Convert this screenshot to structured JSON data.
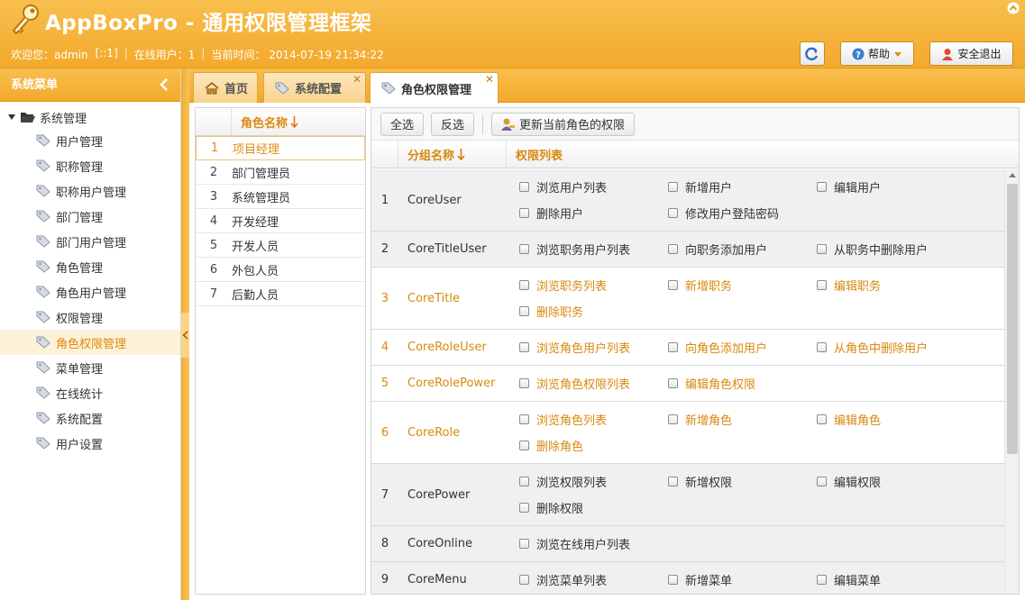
{
  "app": {
    "title": "AppBoxPro - 通用权限管理框架"
  },
  "status": {
    "welcome": "欢迎您：admin",
    "ip": "[::1]",
    "online": "在线用户：1",
    "time": "当前时间：  2014-07-19 21:34:22"
  },
  "header_buttons": {
    "help": "帮助",
    "logout": "安全退出"
  },
  "sidebar": {
    "title": "系统菜单",
    "root": "系统管理",
    "items": [
      {
        "label": "用户管理"
      },
      {
        "label": "职称管理"
      },
      {
        "label": "职称用户管理"
      },
      {
        "label": "部门管理"
      },
      {
        "label": "部门用户管理"
      },
      {
        "label": "角色管理"
      },
      {
        "label": "角色用户管理"
      },
      {
        "label": "权限管理"
      },
      {
        "label": "角色权限管理",
        "active": true
      },
      {
        "label": "菜单管理"
      },
      {
        "label": "在线统计"
      },
      {
        "label": "系统配置"
      },
      {
        "label": "用户设置"
      }
    ]
  },
  "tabs": [
    {
      "label": "首页"
    },
    {
      "label": "系统配置"
    },
    {
      "label": "角色权限管理",
      "active": true
    }
  ],
  "roles": {
    "header": "角色名称",
    "rows": [
      {
        "num": "1",
        "name": "项目经理",
        "selected": true
      },
      {
        "num": "2",
        "name": "部门管理员"
      },
      {
        "num": "3",
        "name": "系统管理员"
      },
      {
        "num": "4",
        "name": "开发经理"
      },
      {
        "num": "5",
        "name": "开发人员"
      },
      {
        "num": "6",
        "name": "外包人员"
      },
      {
        "num": "7",
        "name": "后勤人员"
      }
    ]
  },
  "toolbar": {
    "select_all": "全选",
    "invert": "反选",
    "update": "更新当前角色的权限"
  },
  "powers": {
    "header_group": "分组名称",
    "header_list": "权限列表",
    "rows": [
      {
        "num": "1",
        "group": "CoreUser",
        "style": "grey",
        "items": [
          "浏览用户列表",
          "新增用户",
          "编辑用户",
          "删除用户",
          "修改用户登陆密码"
        ]
      },
      {
        "num": "2",
        "group": "CoreTitleUser",
        "style": "grey",
        "items": [
          "浏览职务用户列表",
          "向职务添加用户",
          "从职务中删除用户"
        ]
      },
      {
        "num": "3",
        "group": "CoreTitle",
        "style": "orange",
        "items": [
          "浏览职务列表",
          "新增职务",
          "编辑职务",
          "删除职务"
        ]
      },
      {
        "num": "4",
        "group": "CoreRoleUser",
        "style": "orange",
        "items": [
          "浏览角色用户列表",
          "向角色添加用户",
          "从角色中删除用户"
        ]
      },
      {
        "num": "5",
        "group": "CoreRolePower",
        "style": "orange",
        "items": [
          "浏览角色权限列表",
          "编辑角色权限"
        ]
      },
      {
        "num": "6",
        "group": "CoreRole",
        "style": "orange",
        "items": [
          "浏览角色列表",
          "新增角色",
          "编辑角色",
          "删除角色"
        ]
      },
      {
        "num": "7",
        "group": "CorePower",
        "style": "grey",
        "items": [
          "浏览权限列表",
          "新增权限",
          "编辑权限",
          "删除权限"
        ]
      },
      {
        "num": "8",
        "group": "CoreOnline",
        "style": "grey",
        "items": [
          "浏览在线用户列表"
        ]
      },
      {
        "num": "9",
        "group": "CoreMenu",
        "style": "grey",
        "items": [
          "浏览菜单列表",
          "新增菜单",
          "编辑菜单"
        ]
      }
    ]
  },
  "colors": {
    "accent": "#f3a92c",
    "highlight": "#d9890e"
  }
}
